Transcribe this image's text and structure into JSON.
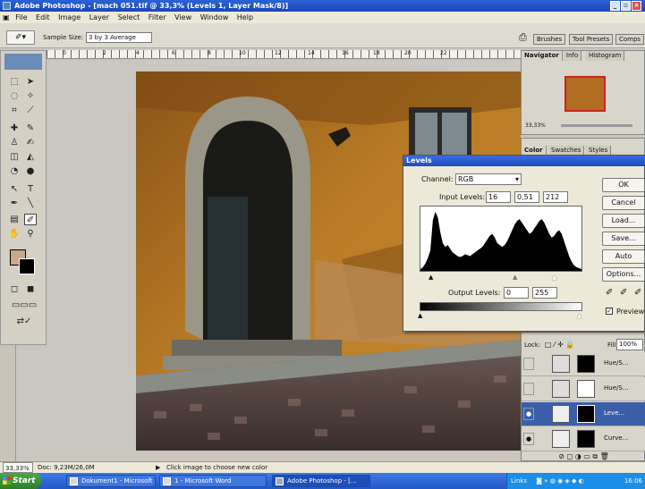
{
  "window": {
    "title": "Adobe Photoshop - [mach 051.tif @ 33,3% (Levels 1, Layer Mask/8)]"
  },
  "menu": [
    "File",
    "Edit",
    "Image",
    "Layer",
    "Select",
    "Filter",
    "View",
    "Window",
    "Help"
  ],
  "options": {
    "sample_label": "Sample Size:",
    "sample_value": "3 by 3 Average",
    "tabs": [
      "Brushes",
      "Tool Presets",
      "Comps"
    ]
  },
  "ruler_numbers": [
    "0",
    "2",
    "4",
    "6",
    "8",
    "10",
    "12",
    "14",
    "16",
    "18",
    "20",
    "22"
  ],
  "navigator": {
    "tabs": [
      "Navigator",
      "Info",
      "Histogram"
    ],
    "zoom": "33,33%"
  },
  "color_panel": {
    "tabs": [
      "Color",
      "Swatches",
      "Styles"
    ]
  },
  "levels": {
    "title": "Levels",
    "channel_label": "Channel:",
    "channel_value": "RGB",
    "input_label": "Input Levels:",
    "input_values": [
      "16",
      "0,51",
      "212"
    ],
    "output_label": "Output Levels:",
    "output_values": [
      "0",
      "255"
    ],
    "buttons": [
      "OK",
      "Cancel",
      "Load...",
      "Save...",
      "Auto",
      "Options..."
    ],
    "preview_label": "Preview",
    "histogram": [
      2,
      4,
      8,
      14,
      22,
      55,
      64,
      58,
      42,
      30,
      26,
      28,
      24,
      20,
      18,
      16,
      15,
      16,
      18,
      17,
      16,
      18,
      20,
      22,
      24,
      26,
      30,
      34,
      38,
      40,
      36,
      30,
      28,
      26,
      28,
      32,
      38,
      44,
      50,
      54,
      56,
      52,
      48,
      44,
      40,
      42,
      46,
      50,
      54,
      56,
      52,
      46,
      40,
      36,
      38,
      42,
      44,
      40,
      32,
      24,
      16,
      10,
      6,
      4,
      3,
      2
    ]
  },
  "layers": {
    "lock_label": "Lock:",
    "fill_label": "Fill:",
    "fill_value": "100%",
    "items": [
      {
        "name": "Hue/S..."
      },
      {
        "name": "Hue/S..."
      },
      {
        "name": "Leve..."
      },
      {
        "name": "Curve..."
      }
    ]
  },
  "status": {
    "zoom": "33,33%",
    "doc": "Doc: 9,23M/26,0M",
    "hint": "Click image to choose new color"
  },
  "taskbar": {
    "start": "Start",
    "tasks": [
      "Dokument1 - Microsoft ...",
      "1 - Microsoft Word",
      "Adobe Photoshop - [..."
    ],
    "links": "Links",
    "time": "16:06"
  }
}
